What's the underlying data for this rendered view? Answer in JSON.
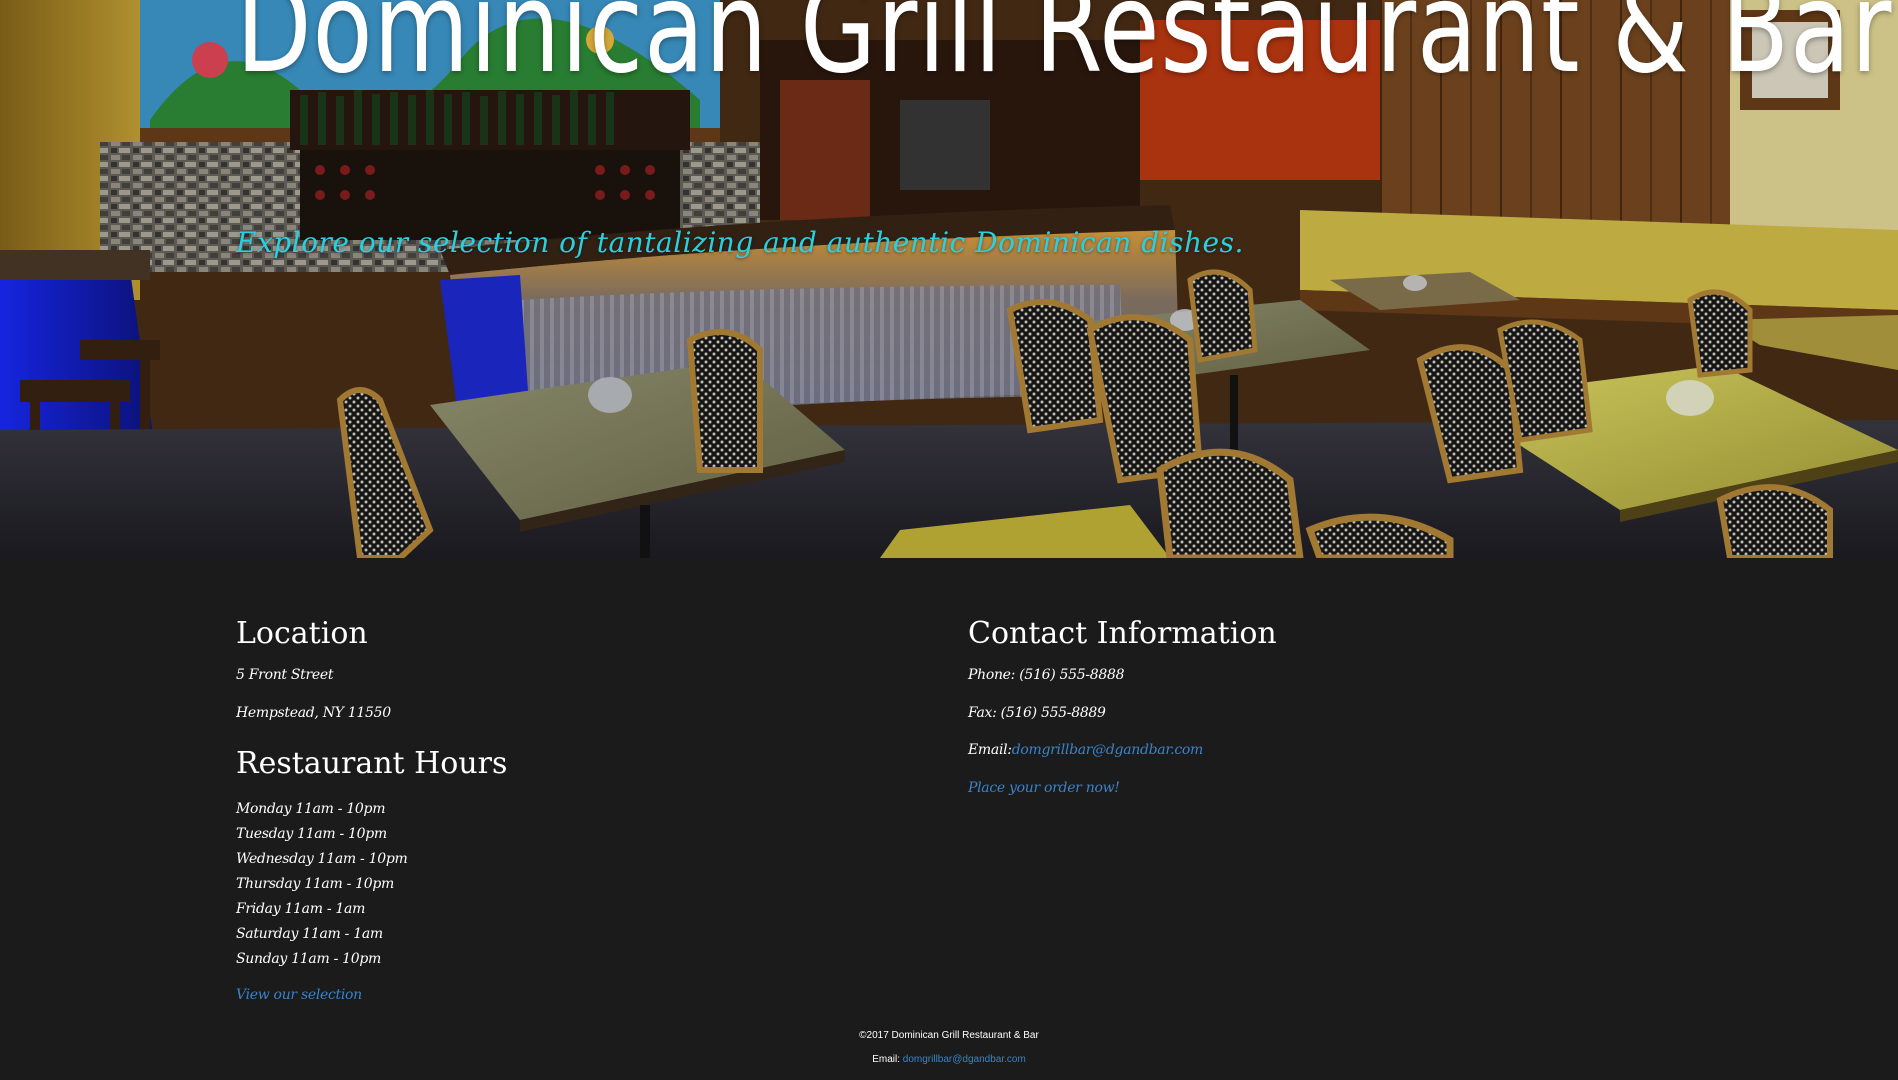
{
  "hero": {
    "title": "Dominican Grill Restaurant & Bar",
    "tagline": "Explore our selection of tantalizing and authentic Dominican dishes."
  },
  "location": {
    "heading": "Location",
    "address_line1": "5 Front Street",
    "address_line2": "Hempstead, NY 11550"
  },
  "hours": {
    "heading": "Restaurant Hours",
    "days": [
      "Monday 11am - 10pm",
      "Tuesday 11am - 10pm",
      "Wednesday 11am - 10pm",
      "Thursday 11am - 10pm",
      "Friday 11am - 1am",
      "Saturday 11am - 1am",
      "Sunday 11am - 10pm"
    ],
    "view_selection_link": "View our selection"
  },
  "contact": {
    "heading": "Contact Information",
    "phone": "Phone: (516) 555-8888",
    "fax": "Fax:  (516) 555-8889",
    "email_label": "Email:",
    "email_value": "domgrillbar@dgandbar.com",
    "order_link": "Place your order now!"
  },
  "footer": {
    "copyright": "©2017 Dominican Grill Restaurant & Bar",
    "email_label": "Email:",
    "email_value": "domgrillbar@dgandbar.com"
  },
  "colors": {
    "background": "#1b1b1b",
    "tagline": "#2ad0e0",
    "link": "#3a83c9"
  }
}
